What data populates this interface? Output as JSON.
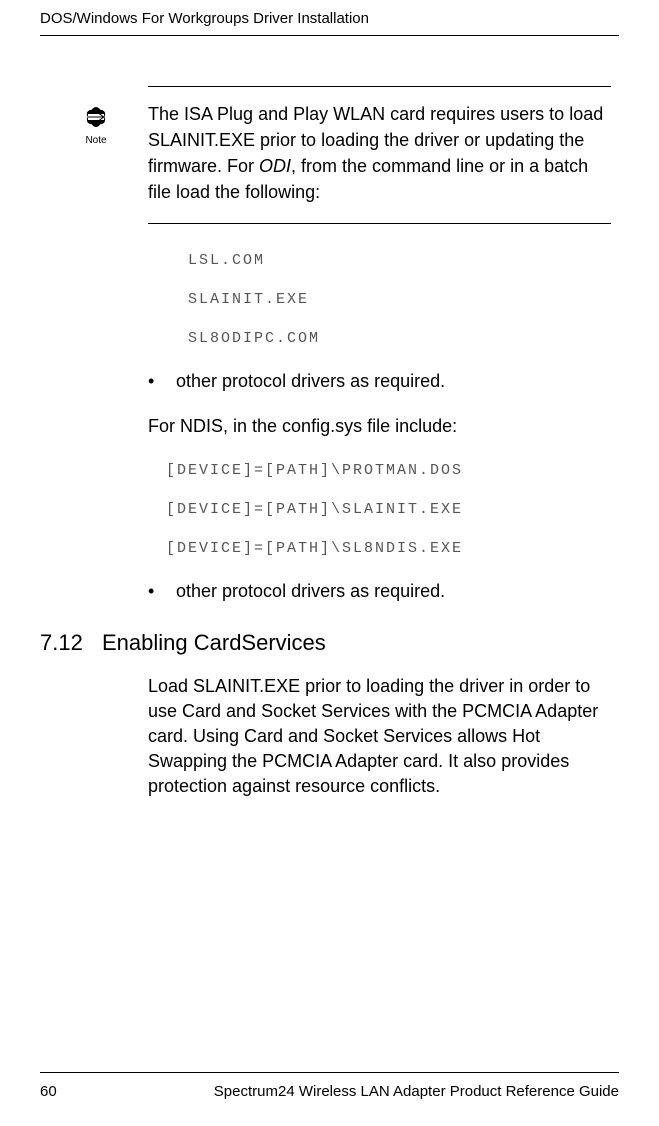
{
  "running_head": "DOS/Windows For Workgroups Driver Installation",
  "note": {
    "icon_label": "Note",
    "text_pre": "The ISA Plug and Play WLAN card requires users to load SLAINIT.EXE prior to loading the driver or updating the firmware. For ",
    "text_italic": "ODI",
    "text_post": ", from the command line or in a batch file load the following:"
  },
  "code1": {
    "l1": "LSL.COM",
    "l2": "SLAINIT.EXE",
    "l3": "SL8ODIPC.COM"
  },
  "bullet1": "other protocol drivers as required.",
  "para_ndis": "For NDIS, in the config.sys file include:",
  "code2": {
    "l1": "[DEVICE]=[PATH]\\PROTMAN.DOS",
    "l2": "[DEVICE]=[PATH]\\SLAINIT.EXE",
    "l3": "[DEVICE]=[PATH]\\SL8NDIS.EXE"
  },
  "bullet2": "other protocol drivers as required.",
  "section": {
    "num": "7.12",
    "title": "Enabling CardServices",
    "body": "Load SLAINIT.EXE prior to loading the driver in order to use Card and Socket Services with the PCMCIA Adapter card. Using Card and Socket Services allows Hot Swapping the PCMCIA Adapter card. It also provides protection against resource conflicts."
  },
  "footer": {
    "page": "60",
    "title": "Spectrum24 Wireless LAN Adapter Product Reference Guide"
  }
}
